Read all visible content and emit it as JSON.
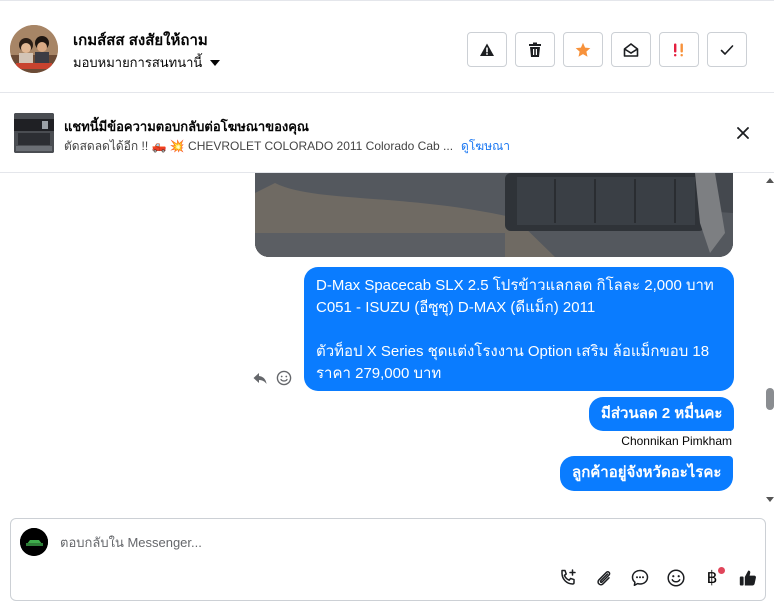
{
  "header": {
    "contact_name": "เกมส์สส สงสัยให้ถาม",
    "assign_label": "มอบหมายการสนทนานี้",
    "actions": [
      "alert-icon",
      "trash-icon",
      "star-icon",
      "mark-unread-icon",
      "spam-icon",
      "check-icon"
    ],
    "star_color": "#f7923b",
    "spam_color": "#e41e3f"
  },
  "ad": {
    "title": "แชทนี้มีข้อความตอบกลับต่อโฆษณาของคุณ",
    "preview": "ตัดสดลดได้อีก !! 🛻 💥 CHEVROLET COLORADO 2011 Colorado Cab ...",
    "link": "ดูโฆษณา"
  },
  "messages": {
    "long_line1": "D-Max Spacecab SLX 2.5 โปรข้าวแลกลด กิโลละ 2,000 บาท",
    "long_line2": "C051 - ISUZU (อีซูซุ) D-MAX (ดีแม็ก) 2011",
    "long_line3": "",
    "long_line4": " ตัวท็อป X Series ชุดแต่งโรงงาน Option เสริม ล้อแม็กขอบ 18",
    "long_line5": "ราคา 279,000 บาท",
    "discount": "มีส่วนลด 2 หมื่นคะ",
    "sender": "Chonnikan Pimkham",
    "question": "ลูกค้าอยู่จังหวัดอะไรคะ"
  },
  "composer": {
    "placeholder": "ตอบกลับใน Messenger...",
    "tools": [
      "call-add-icon",
      "attach-icon",
      "chat-bubble-icon",
      "emoji-icon",
      "baht-icon",
      "thumbs-up-icon"
    ],
    "baht_symbol": "฿"
  },
  "colors": {
    "bubble": "#0a7cff",
    "link": "#1876f2"
  }
}
